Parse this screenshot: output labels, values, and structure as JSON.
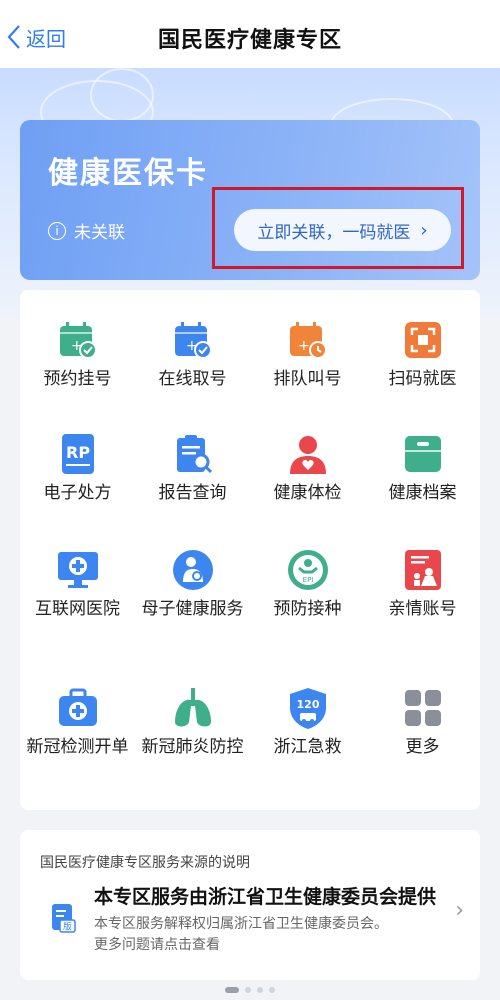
{
  "nav": {
    "back_label": "返回",
    "title": "国民医疗健康专区"
  },
  "card": {
    "title": "健康医保卡",
    "status": "未关联",
    "link_button": "立即关联，一码就医"
  },
  "grid": [
    {
      "label": "预约挂号",
      "icon": "calendar-check-icon",
      "color": "#3fae8a"
    },
    {
      "label": "在线取号",
      "icon": "calendar-check-blue-icon",
      "color": "#3d86f0"
    },
    {
      "label": "排队叫号",
      "icon": "calendar-clock-icon",
      "color": "#f08438"
    },
    {
      "label": "扫码就医",
      "icon": "scan-icon",
      "color": "#f07a3a"
    },
    {
      "label": "电子处方",
      "icon": "prescription-icon",
      "color": "#3d86f0"
    },
    {
      "label": "报告查询",
      "icon": "report-search-icon",
      "color": "#3d86f0"
    },
    {
      "label": "健康体检",
      "icon": "checkup-person-icon",
      "color": "#e9474b"
    },
    {
      "label": "健康档案",
      "icon": "health-file-icon",
      "color": "#3fae8a"
    },
    {
      "label": "互联网医院",
      "icon": "internet-hospital-icon",
      "color": "#3d86f0"
    },
    {
      "label": "母子健康服务",
      "icon": "mother-child-icon",
      "color": "#3d86f0"
    },
    {
      "label": "预防接种",
      "icon": "vaccination-icon",
      "color": "#3fae8a",
      "badge": "EPI"
    },
    {
      "label": "亲情账号",
      "icon": "family-account-icon",
      "color": "#e9474b"
    },
    {
      "label": "新冠检测开单",
      "icon": "medical-kit-icon",
      "color": "#3d86f0"
    },
    {
      "label": "新冠肺炎防控",
      "icon": "lungs-icon",
      "color": "#3fae8a"
    },
    {
      "label": "浙江急救",
      "icon": "emergency-120-icon",
      "color": "#3d86f0",
      "badge": "120"
    },
    {
      "label": "更多",
      "icon": "more-grid-icon",
      "color": "#8a8f99"
    }
  ],
  "notice": {
    "heading": "国民医疗健康专区服务来源的说明",
    "title": "本专区服务由浙江省卫生健康委员会提供",
    "desc1": "本专区服务解释权归属浙江省卫生健康委员会。",
    "desc2": "更多问题请点击查看",
    "icon_badge": "版"
  },
  "colors": {
    "accent": "#2f7cf6",
    "highlight": "#d0192b"
  }
}
